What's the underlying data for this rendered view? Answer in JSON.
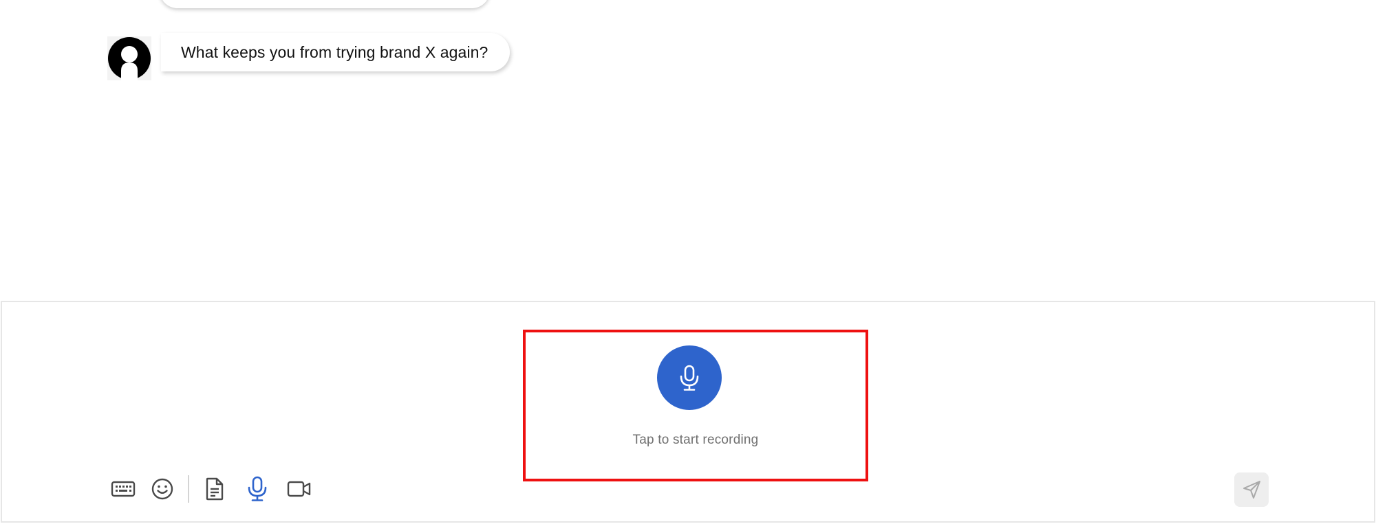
{
  "chat": {
    "messages": [
      {
        "sender": "bot",
        "text": "What keeps you from trying brand X again?"
      }
    ]
  },
  "composer": {
    "record_label": "Tap to start recording",
    "active_mode": "microphone",
    "tools": [
      {
        "name": "keyboard",
        "icon": "keyboard-icon"
      },
      {
        "name": "emoji",
        "icon": "smiley-icon"
      },
      {
        "name": "file",
        "icon": "document-icon"
      },
      {
        "name": "microphone",
        "icon": "microphone-icon"
      },
      {
        "name": "video",
        "icon": "video-camera-icon"
      }
    ],
    "send_icon": "paper-plane-icon"
  },
  "colors": {
    "accent": "#2e64cc",
    "highlight_box": "#ee1111",
    "icon_default": "#4a4a4a",
    "send_disabled_bg": "#eeeeee"
  }
}
